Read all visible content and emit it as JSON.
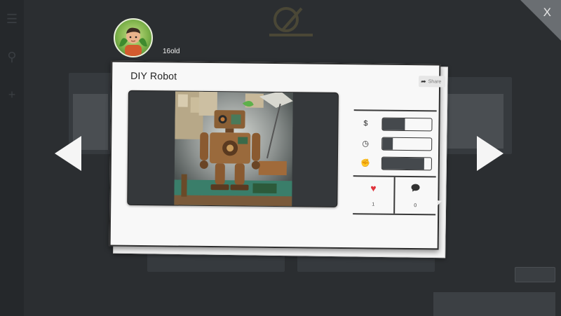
{
  "app": {
    "logo_label": "",
    "close_label": "X"
  },
  "profile": {
    "username": "16old"
  },
  "post": {
    "title": "DIY Robot",
    "share_label": "Share",
    "artwork_subject": "robot-illustration"
  },
  "stats": [
    {
      "icon": "dollar-icon",
      "glyph": "$",
      "level": 0.45
    },
    {
      "icon": "clock-icon",
      "glyph": "◷",
      "level": 0.22
    },
    {
      "icon": "fist-icon",
      "glyph": "✊",
      "level": 0.85
    }
  ],
  "reactions": {
    "likes": {
      "icon": "heart-icon",
      "count": "1"
    },
    "comments": {
      "icon": "comment-icon",
      "count": "0"
    }
  },
  "colors": {
    "accent_heart": "#e0343c",
    "bar_fill": "#45494d",
    "backdrop": "#2b2e31"
  }
}
